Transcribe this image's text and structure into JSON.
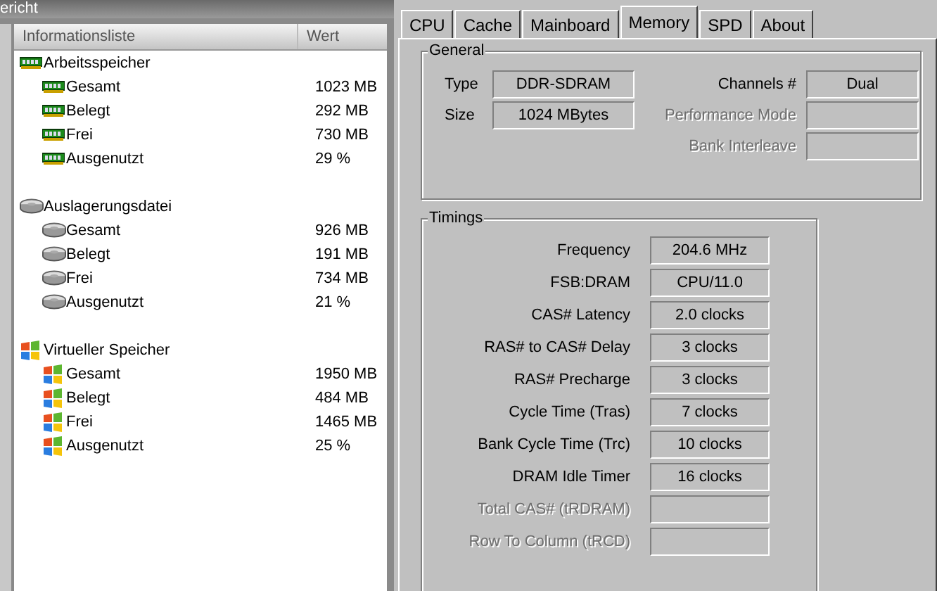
{
  "left_window": {
    "title": "ericht",
    "list": {
      "columns": [
        "Informationsliste",
        "Wert"
      ],
      "groups": [
        {
          "kind": "ram",
          "label": "Arbeitsspeicher",
          "items": [
            {
              "label": "Gesamt",
              "value": "1023 MB"
            },
            {
              "label": "Belegt",
              "value": "292 MB"
            },
            {
              "label": "Frei",
              "value": "730 MB"
            },
            {
              "label": "Ausgenutzt",
              "value": "29 %"
            }
          ]
        },
        {
          "kind": "disk",
          "label": "Auslagerungsdatei",
          "items": [
            {
              "label": "Gesamt",
              "value": "926 MB"
            },
            {
              "label": "Belegt",
              "value": "191 MB"
            },
            {
              "label": "Frei",
              "value": "734 MB"
            },
            {
              "label": "Ausgenutzt",
              "value": "21 %"
            }
          ]
        },
        {
          "kind": "windows",
          "label": "Virtueller Speicher",
          "items": [
            {
              "label": "Gesamt",
              "value": "1950 MB"
            },
            {
              "label": "Belegt",
              "value": "484 MB"
            },
            {
              "label": "Frei",
              "value": "1465 MB"
            },
            {
              "label": "Ausgenutzt",
              "value": "25 %"
            }
          ]
        }
      ]
    }
  },
  "right_window": {
    "tabs": [
      {
        "label": "CPU",
        "selected": false
      },
      {
        "label": "Cache",
        "selected": false
      },
      {
        "label": "Mainboard",
        "selected": false
      },
      {
        "label": "Memory",
        "selected": true
      },
      {
        "label": "SPD",
        "selected": false
      },
      {
        "label": "About",
        "selected": false
      }
    ],
    "general": {
      "title": "General",
      "left_fields": [
        {
          "label": "Type",
          "value": "DDR-SDRAM"
        },
        {
          "label": "Size",
          "value": "1024 MBytes"
        }
      ],
      "right_fields": [
        {
          "label": "Channels #",
          "value": "Dual",
          "disabled": false
        },
        {
          "label": "Performance Mode",
          "disabled": true
        },
        {
          "label": "Bank Interleave",
          "disabled": true
        }
      ]
    },
    "timings": {
      "title": "Timings",
      "fields": [
        {
          "label": "Frequency",
          "value": "204.6 MHz",
          "disabled": false
        },
        {
          "label": "FSB:DRAM",
          "value": "CPU/11.0",
          "disabled": false
        },
        {
          "label": "CAS# Latency",
          "value": "2.0 clocks",
          "disabled": false
        },
        {
          "label": "RAS# to CAS# Delay",
          "value": "3 clocks",
          "disabled": false
        },
        {
          "label": "RAS# Precharge",
          "value": "3 clocks",
          "disabled": false
        },
        {
          "label": "Cycle Time (Tras)",
          "value": "7 clocks",
          "disabled": false
        },
        {
          "label": "Bank Cycle Time (Trc)",
          "value": "10 clocks",
          "disabled": false
        },
        {
          "label": "DRAM Idle Timer",
          "value": "16 clocks",
          "disabled": false
        },
        {
          "label": "Total CAS# (tRDRAM)",
          "disabled": true
        },
        {
          "label": "Row To Column (tRCD)",
          "disabled": true
        }
      ]
    }
  }
}
